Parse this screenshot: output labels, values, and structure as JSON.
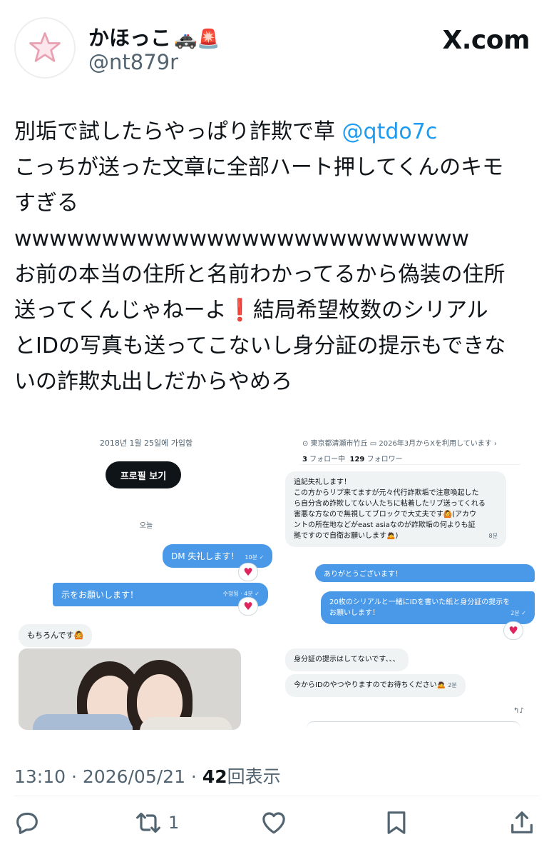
{
  "author": {
    "name": "かほっこ",
    "name_emoji": "🚓🚨",
    "handle": "@nt879r"
  },
  "site": {
    "logo": "X.com"
  },
  "tweet": {
    "lines": [
      {
        "text": "別垢で試したらやっぱり詐欺で草 ",
        "mention": "@qtdo7c"
      },
      {
        "text": "こっちが送った文章に全部ハート押してくんのキモ"
      },
      {
        "text": "すぎる"
      },
      {
        "text": "wwwwwwwwwwwwwwwwwwwwwwwwww"
      },
      {
        "text": "お前の本当の住所と名前わかってるから偽装の住所"
      },
      {
        "text": "送ってくんじゃねーよ",
        "emoji": "❗️",
        "rest": "結局希望枚数のシリアル"
      },
      {
        "text": "とIDの写真も送ってこないし身分証の提示もできな"
      },
      {
        "text": "いの詐欺丸出しだからやめろ"
      }
    ]
  },
  "media": {
    "left": {
      "joined": "2018년 1월 25일에 가입함",
      "profile_button": "프로필 보기",
      "date_divider": "오늘",
      "msg1": {
        "text": "DM 失礼します！",
        "meta": "10분 ✓"
      },
      "msg2": {
        "text": "示をお願いします！",
        "meta": "수정됨 · 4분 ✓"
      },
      "msg3": {
        "text": "もちろんです🙆"
      },
      "heart": "♥"
    },
    "right": {
      "location": "⊙ 東京都清瀬市竹丘   ▭ 2026年3月からXを利用しています  ›",
      "following_count": "3",
      "following_label": "フォロー中",
      "followers_count": "129",
      "followers_label": "フォロワー",
      "msg_a": {
        "lines": [
          "追記失礼します！",
          "この方からリプ来てますが元々代行詐欺垢で注意喚起した",
          "ら自分含め詐欺してない人たちに粘着したリプ送ってくれる",
          "害悪な方なので無視してブロックで大丈夫です🙆(アカウ",
          "ントの所在地などがeast asiaなのが詐欺垢の何よりも証",
          "拠ですので自衛お願いします🙇)"
        ],
        "meta": "8분"
      },
      "msg_b": {
        "text": "ありがとうございます！"
      },
      "msg_c": {
        "lines": [
          "20枚のシリアルと一緒にIDを書いた紙と身分証の提示を",
          "お願いします！"
        ],
        "meta": "2분 ✓"
      },
      "msg_d": {
        "text": "身分証の提示はしてないです、、、"
      },
      "msg_e": {
        "text": "今からIDのやつやりますのでお待ちください🙇",
        "meta": "2분"
      },
      "heart": "♥"
    }
  },
  "footer": {
    "time": "13:10",
    "sep1": " · ",
    "date": "2026/05/21",
    "sep2": " · ",
    "views": "42",
    "views_label": "回表示",
    "retweets": "1"
  },
  "colors": {
    "accent": "#1d9bf0",
    "dm_bubble": "#4a99e9",
    "heart": "#e0245e"
  }
}
